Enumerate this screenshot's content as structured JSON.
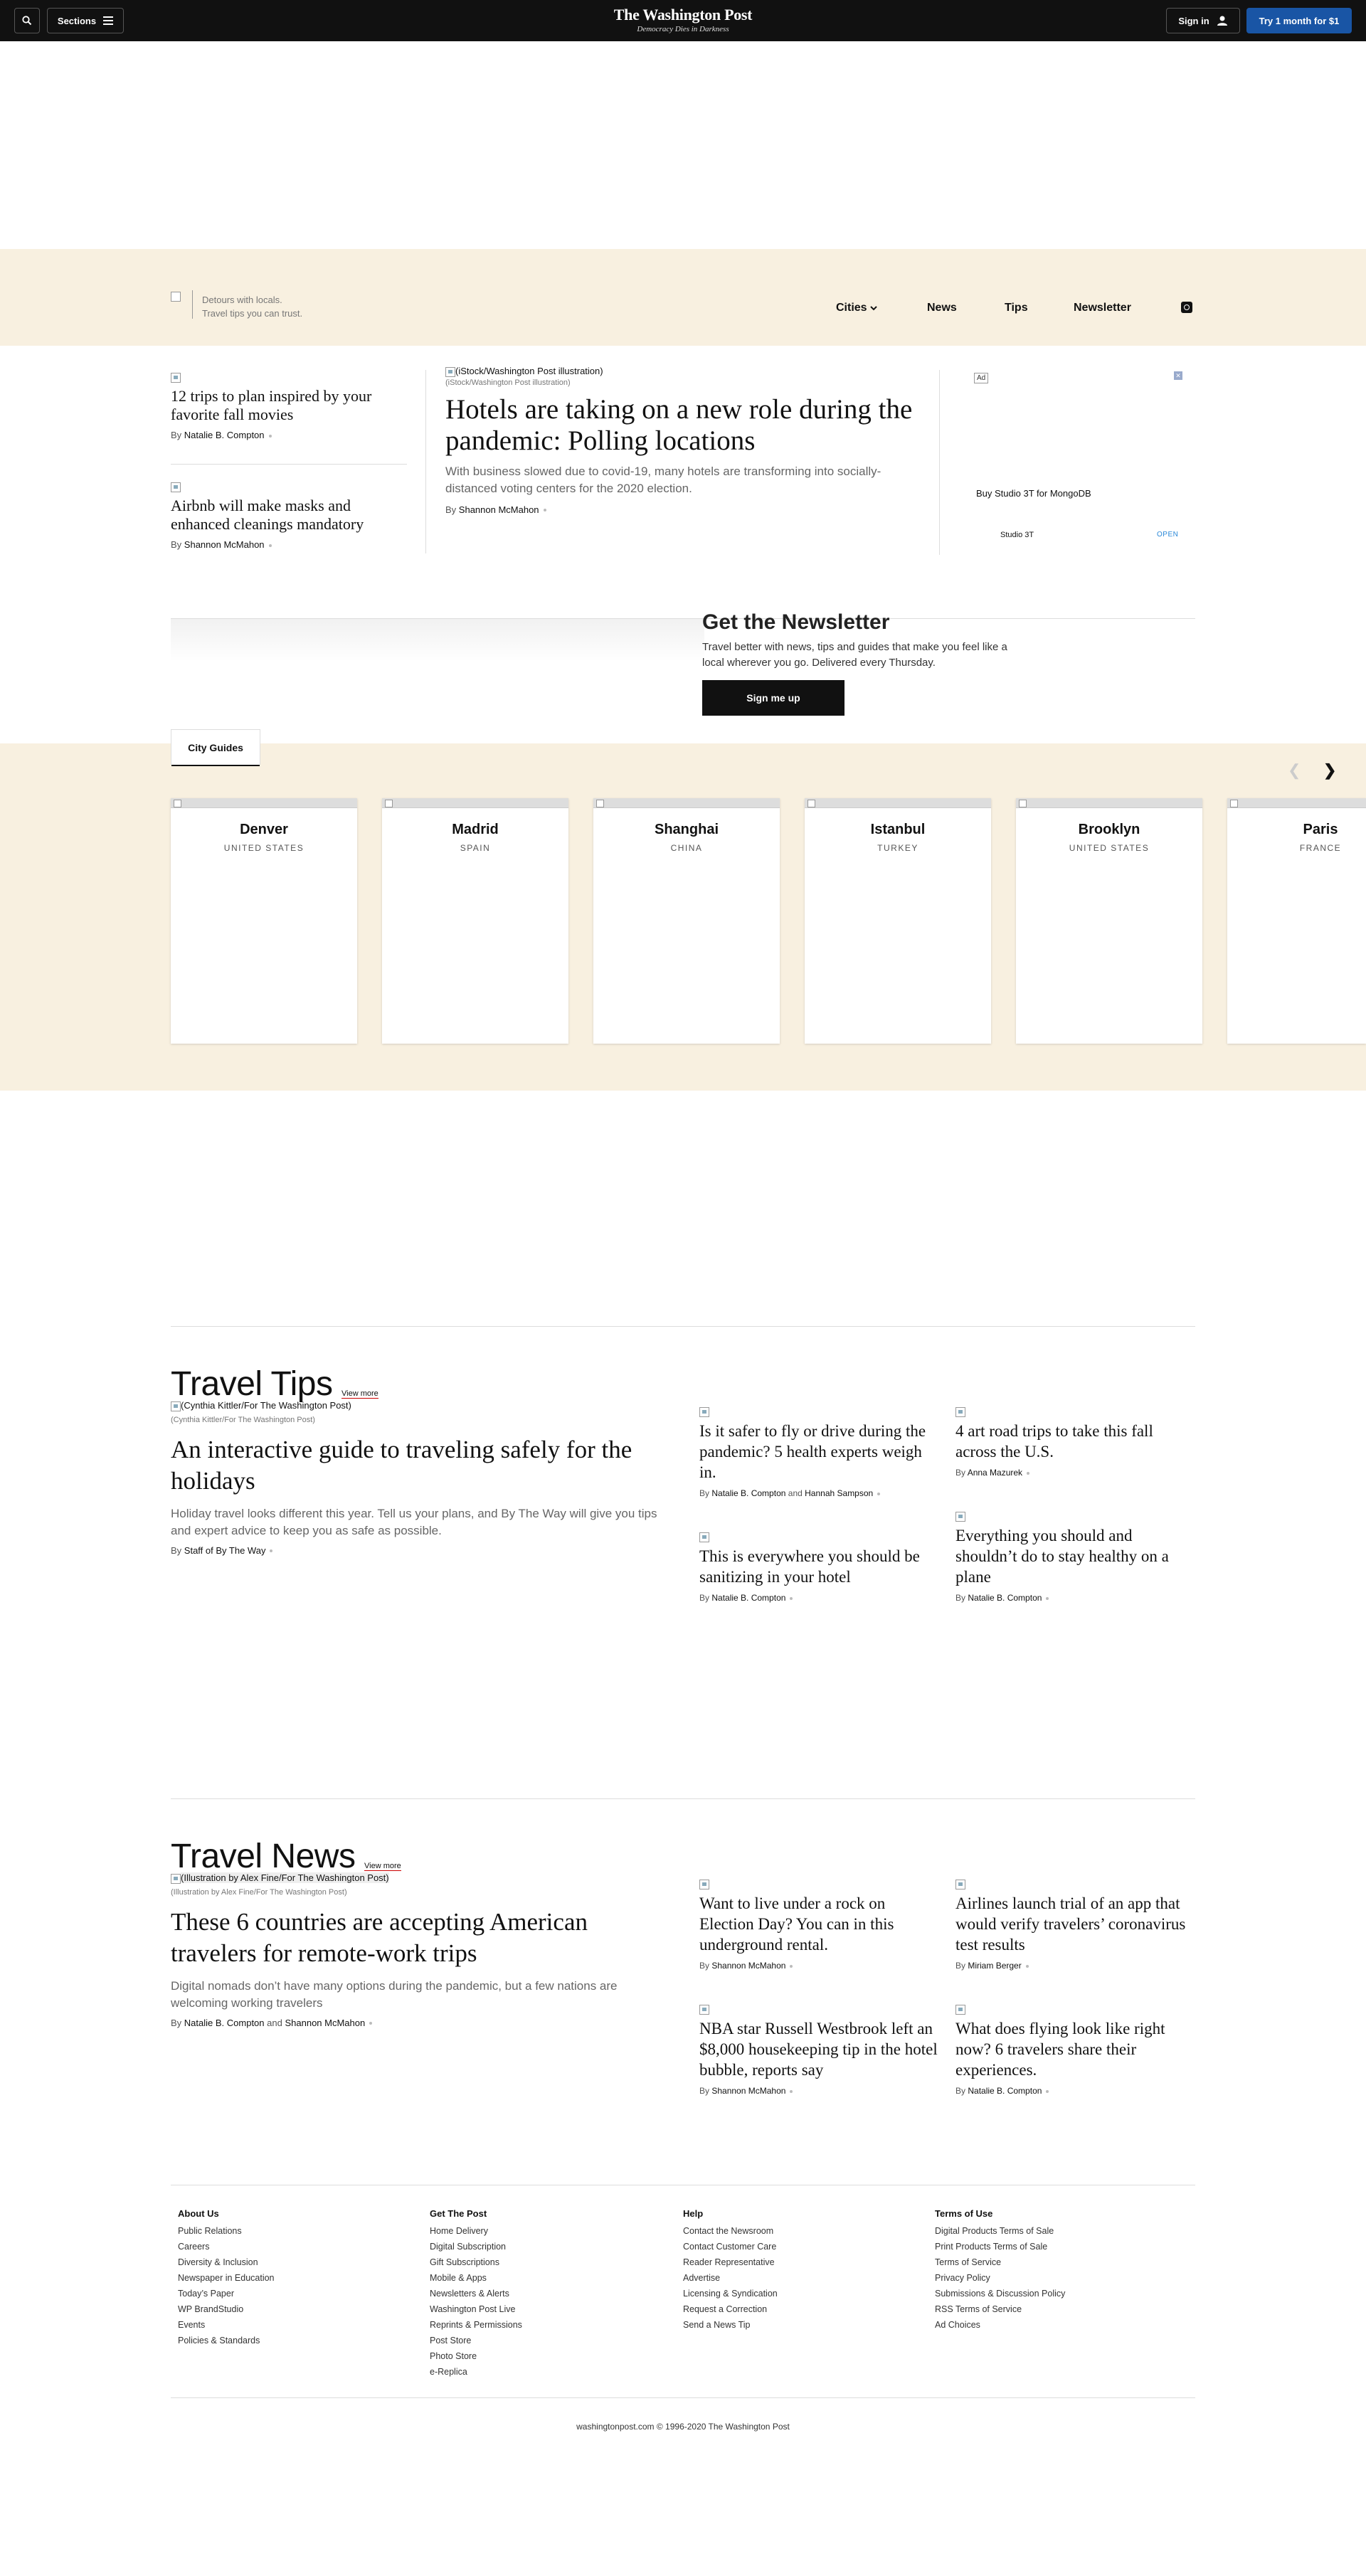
{
  "topbar": {
    "sections_label": "Sections",
    "logo": "The Washington Post",
    "tagline": "Democracy Dies in Darkness",
    "signin_label": "Sign in",
    "try_label": "Try 1 month for $1"
  },
  "subnav": {
    "tagline_1": "Detours with locals.",
    "tagline_2": "Travel tips you can trust.",
    "items": [
      "Cities",
      "News",
      "Tips",
      "Newsletter"
    ]
  },
  "top_stories": {
    "left": [
      {
        "headline": "12 trips to plan inspired by your favorite fall movies",
        "by": "By",
        "author": "Natalie B. Compton"
      },
      {
        "headline": "Airbnb will make masks and enhanced cleanings mandatory",
        "by": "By",
        "author": "Shannon McMahon"
      }
    ],
    "main": {
      "img_alt": "(iStock/Washington Post illustration)",
      "caption": "(iStock/Washington Post illustration)",
      "headline": "Hotels are taking on a new role during the pandemic: Polling locations",
      "blurb": "With business slowed due to covid-19, many hotels are transforming into socially-distanced voting centers for the 2020 election.",
      "by": "By",
      "author": "Shannon McMahon"
    }
  },
  "ad": {
    "label": "Ad",
    "close": "✕",
    "title": "Buy Studio 3T for MongoDB",
    "brand": "Studio 3T",
    "cta": "OPEN"
  },
  "newsletter": {
    "title": "Get the Newsletter",
    "description": "Travel better with news, tips and guides that make you feel like a local wherever you go. Delivered every Thursday.",
    "button": "Sign me up"
  },
  "city_guides": {
    "tab": "City Guides",
    "cities": [
      {
        "name": "Denver",
        "country": "UNITED STATES"
      },
      {
        "name": "Madrid",
        "country": "SPAIN"
      },
      {
        "name": "Shanghai",
        "country": "CHINA"
      },
      {
        "name": "Istanbul",
        "country": "TURKEY"
      },
      {
        "name": "Brooklyn",
        "country": "UNITED STATES"
      },
      {
        "name": "Paris",
        "country": "FRANCE"
      }
    ]
  },
  "travel_tips": {
    "title": "Travel Tips",
    "view_more": "View more",
    "main": {
      "img_alt": "(Cynthia Kittler/For The Washington Post)",
      "caption": "(Cynthia Kittler/For The Washington Post)",
      "headline": "An interactive guide to traveling safely for the holidays",
      "blurb": "Holiday travel looks different this year. Tell us your plans, and By The Way will give you tips and expert advice to keep you as safe as possible.",
      "by": "By",
      "author": "Staff of By The Way"
    },
    "items": [
      {
        "headline": "Is it safer to fly or drive during the pandemic? 5 health experts weigh in.",
        "by": "By",
        "author": "Natalie B. Compton",
        "and": "and",
        "author2": "Hannah Sampson"
      },
      {
        "headline": "4 art road trips to take this fall across the U.S.",
        "by": "By",
        "author": "Anna Mazurek"
      },
      {
        "headline": "This is everywhere you should be sanitizing in your hotel",
        "by": "By",
        "author": "Natalie B. Compton"
      },
      {
        "headline": "Everything you should and shouldn’t do to stay healthy on a plane",
        "by": "By",
        "author": "Natalie B. Compton"
      }
    ]
  },
  "travel_news": {
    "title": "Travel News",
    "view_more": "View more",
    "main": {
      "img_alt": "(Illustration by Alex Fine/For The Washington Post)",
      "caption": "(Illustration by Alex Fine/For The Washington Post)",
      "headline": "These 6 countries are accepting American travelers for remote-work trips",
      "blurb": "Digital nomads don’t have many options during the pandemic, but a few nations are welcoming working travelers",
      "by": "By",
      "author": "Natalie B. Compton",
      "and": "and",
      "author2": "Shannon McMahon"
    },
    "items": [
      {
        "headline": "Want to live under a rock on Election Day? You can in this underground rental.",
        "by": "By",
        "author": "Shannon McMahon"
      },
      {
        "headline": "Airlines launch trial of an app that would verify travelers’ coronavirus test results",
        "by": "By",
        "author": "Miriam Berger"
      },
      {
        "headline": "NBA star Russell Westbrook left an $8,000 housekeeping tip in the hotel bubble, reports say",
        "by": "By",
        "author": "Shannon McMahon"
      },
      {
        "headline": "What does flying look like right now? 6 travelers share their experiences.",
        "by": "By",
        "author": "Natalie B. Compton"
      }
    ]
  },
  "footer": {
    "columns": [
      {
        "title": "About Us",
        "links": [
          "Public Relations",
          "Careers",
          "Diversity & Inclusion",
          "Newspaper in Education",
          "Today’s Paper",
          "WP BrandStudio",
          "Events",
          "Policies & Standards"
        ]
      },
      {
        "title": "Get The Post",
        "links": [
          "Home Delivery",
          "Digital Subscription",
          "Gift Subscriptions",
          "Mobile & Apps",
          "Newsletters & Alerts",
          "Washington Post Live",
          "Reprints & Permissions",
          "Post Store",
          "Photo Store",
          "e-Replica"
        ]
      },
      {
        "title": "Help",
        "links": [
          "Contact the Newsroom",
          "Contact Customer Care",
          "Reader Representative",
          "Advertise",
          "Licensing & Syndication",
          "Request a Correction",
          "Send a News Tip"
        ]
      },
      {
        "title": "Terms of Use",
        "links": [
          "Digital Products Terms of Sale",
          "Print Products Terms of Sale",
          "Terms of Service",
          "Privacy Policy",
          "Submissions & Discussion Policy",
          "RSS Terms of Service",
          "Ad Choices"
        ]
      }
    ],
    "copyright": "washingtonpost.com © 1996-2020 The Washington Post"
  }
}
